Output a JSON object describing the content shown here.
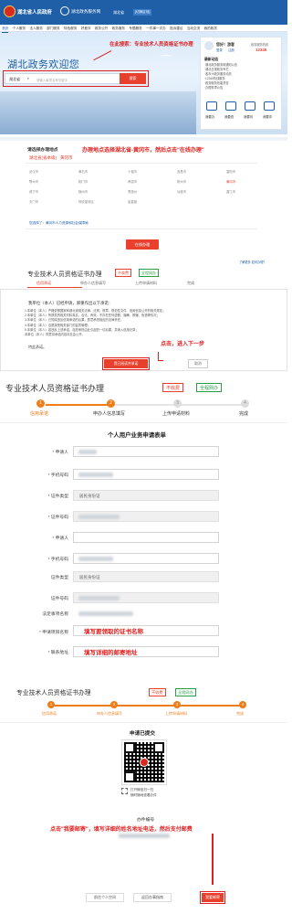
{
  "header": {
    "gov_name": "湖北省人民政府",
    "portal_name": "湖北政务服务网",
    "location": "湖北省",
    "switch_label": "[切换区划]",
    "nav": [
      "首页",
      "个人服务",
      "法人服务",
      "部门服务",
      "特色服务",
      "好差评",
      "政务公开",
      "政务服务",
      "专题服务",
      "一件事一次办",
      "投诉建议",
      "互动交流",
      "我的政务"
    ],
    "welcome": "湖北政务欢迎您",
    "search_scope": "湖北省",
    "search_placeholder": "请输入事项名称关键字",
    "search_button": "搜索",
    "annot_1": "在此搜索：专业技术人员资格证书办理",
    "user": {
      "greeting": "您好！游客",
      "login": "登录",
      "register": "注册",
      "hotline_label": "政务服务热线",
      "hotline_number": "12345",
      "section": "最新动态"
    },
    "news": [
      "·湖北政务服务网通知公告",
      "·湖北日报政务专栏",
      "·各市州政务服务动态",
      "·12345热线服务",
      "·政务服务效能督查",
      "·办理事项公告"
    ],
    "tiles": [
      "我要办",
      "我要查",
      "我要问",
      "我要评"
    ]
  },
  "region": {
    "title": "请选择办理地点",
    "province": "湖北省(省本级)",
    "city": "黄冈市",
    "annot": "办理地点选择湖北省-黄冈市，然后点击\"在线办理\"",
    "cities": [
      "武汉市",
      "黄石市",
      "十堰市",
      "宜昌市",
      "襄阳市",
      "鄂州市",
      "荆门市",
      "孝感市",
      "荆州市",
      "黄冈市",
      "咸宁市",
      "随州市",
      "恩施州",
      "仙桃市",
      "潜江市",
      "天门市",
      "神农架林区",
      "省直管"
    ],
    "selected_note": "您选择了：黄冈市人力资源和社会保障局",
    "button": "在线办理",
    "faq": "了解更多 如何办理？"
  },
  "commitment": {
    "title": "专业技术人员资格证书办理",
    "badge1": "不收费",
    "badge2": "全程网办",
    "steps": [
      "信用承诺",
      "申办人信息填写",
      "上传申请材料",
      "完成"
    ],
    "intro": "我单位（本人）已经申请，郑重作出以下承诺：",
    "items": [
      "1.本单位（本人）严格依照国家和湖北省相关法律、法规、规章、规范性文件、信用信息公开的相关规定；",
      "2.本单位（本人）所提供的相关材料真实、合法、有效，不存在任何虚假、隐瞒、欺骗、伪造等情况；",
      "3.本单位（本人）已知晓违反信用承诺的后果，愿意承担相应的法律责任；",
      "4.本单位（本人）自愿接受相关部门的监督管理；",
      "5.本单位（本人）若违反上述承诺，自愿承担由此引起的一切后果，并纳入信用记录；",
      "本单位（本人）同意将承诺内容向社会公开。"
    ],
    "closing": "特此承诺。",
    "annot": "点击，进入下一步",
    "agree_button": "我已阅读并承诺",
    "cancel_button": "取消"
  },
  "form": {
    "title": "专业技术人员资格证书办理",
    "badge1": "不收费",
    "badge2": "全程网办",
    "steps": [
      "信用承诺",
      "申办人信息填写",
      "上传申请材料",
      "完成"
    ],
    "heading": "个人用户业务申请表单",
    "labels": [
      "* 申请人",
      "* 手机号码",
      "* 证件类型",
      "* 证件号码",
      "* 申请人",
      "* 手机号码",
      "证件类型",
      "证件号码",
      "法定事项名称",
      "* 申请项目名称",
      "* 联系地址"
    ],
    "id_type": "居民身份证",
    "id_type2": "居民身份证",
    "annot_name": "填写要领取的证书名称",
    "annot_addr": "填写详细的邮寄地址"
  },
  "done": {
    "title": "专业技术人员资格证书办理",
    "badge1": "不收费",
    "badge2": "全程网办",
    "steps": [
      "信用承诺",
      "申办人信息填写",
      "上传申请材料",
      "完成"
    ],
    "heading": "申请已提交",
    "qr_caption1": "打开微信扫一扫",
    "qr_caption2": "随时随地查看办件",
    "case_label": "办件编号",
    "annot": "点击\"我要邮寄\"，填写详细的姓名地址电话，然后支付邮费",
    "btn_back": "前往个人空间",
    "btn_matters": "返回办事指南",
    "btn_mail": "我要邮寄"
  },
  "colors": {
    "primary": "#1e5fa8",
    "accent": "#e8402d",
    "annot": "#e02020",
    "step": "#ef7d1a"
  }
}
